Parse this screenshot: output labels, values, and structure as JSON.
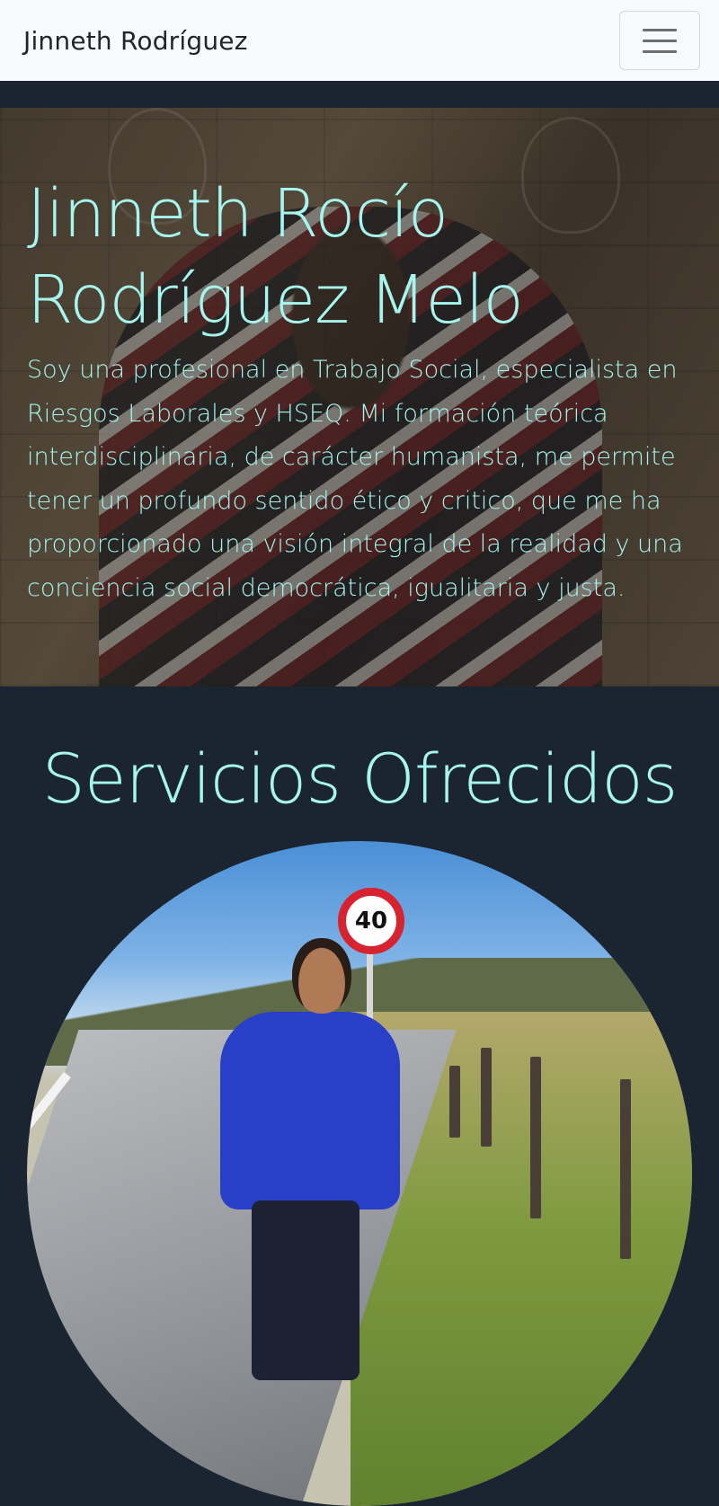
{
  "navbar": {
    "brand": "Jinneth Rodríguez",
    "toggle_icon": "hamburger-menu-icon"
  },
  "hero": {
    "title": "Jinneth Rocío Rodríguez Melo",
    "description": "Soy una profesional en Trabajo Social, especialista en Riesgos Laborales y HSEQ. Mi formación teórica interdisciplinaria, de carácter humanista, me permite tener un profundo sentido ético y critico, que me ha proporcionado una visión integral de la realidad y una conciencia social democrática, igualitaria y justa."
  },
  "services": {
    "title": "Servicios Ofrecidos",
    "photo_sign_text": "40"
  },
  "colors": {
    "accent_text": "#a6f5ee",
    "page_background": "#1b2532",
    "navbar_background": "#f8f9fa"
  }
}
